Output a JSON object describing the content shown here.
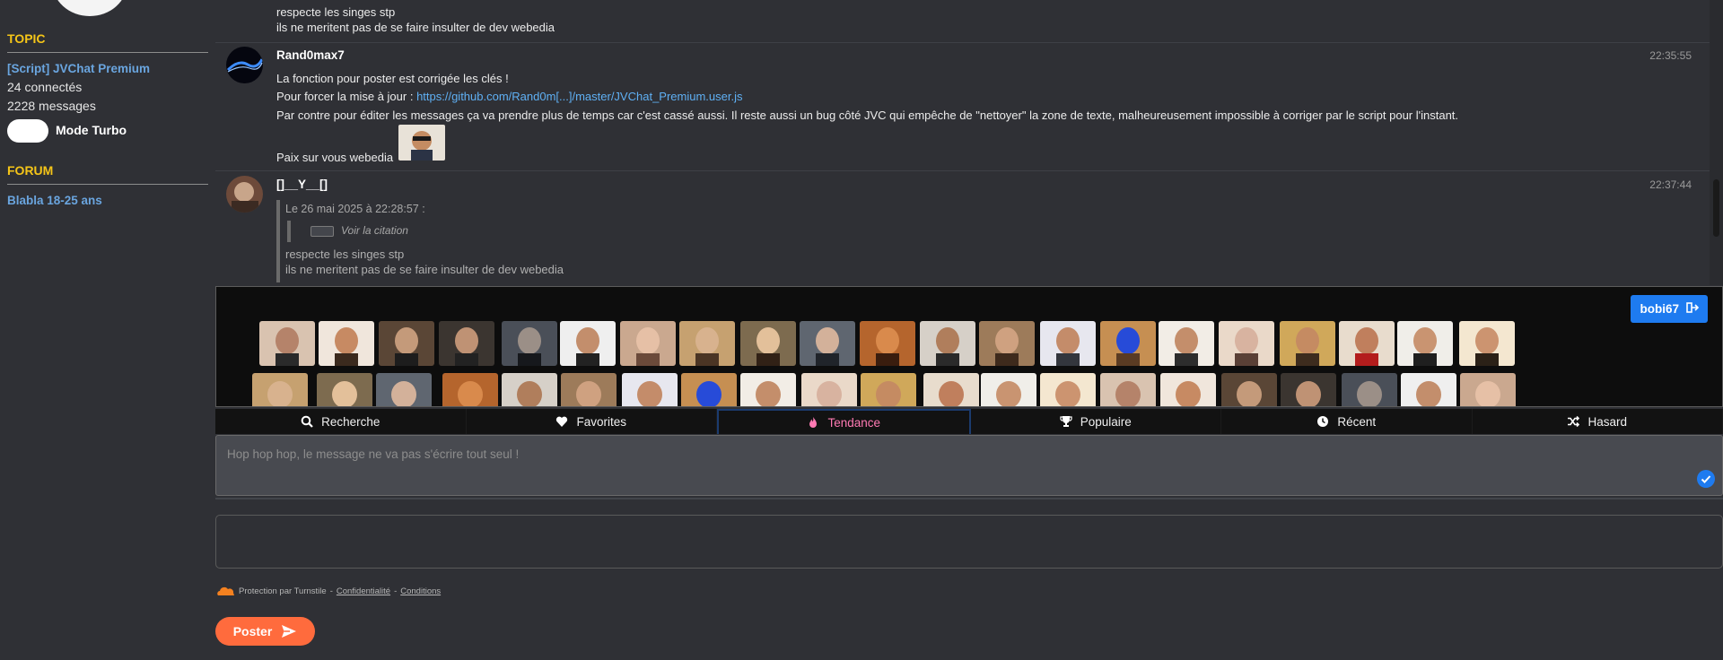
{
  "sidebar": {
    "topic_heading": "TOPIC",
    "topic_title": "[Script] JVChat Premium",
    "connected": "24 connectés",
    "messages": "2228 messages",
    "turbo_label": "Mode Turbo",
    "forum_heading": "FORUM",
    "forum_name": "Blabla 18-25 ans"
  },
  "messages": [
    {
      "lines": [
        "respecte les singes stp",
        "ils ne meritent pas de se faire insulter de dev webedia"
      ]
    },
    {
      "author": "Rand0max7",
      "time": "22:35:55",
      "line1": "La fonction pour poster est corrigée les clés !",
      "line2_prefix": "Pour forcer la mise à jour : ",
      "line2_link": "https://github.com/Rand0m[...]/master/JVChat_Premium.user.js",
      "line3": "Par contre pour éditer les messages ça va prendre plus de temps car c'est cassé aussi. Il reste aussi un bug côté JVC qui empêche de \"nettoyer\" la zone de texte, malheureusement impossible à corriger par le script pour l'instant.",
      "line4": "Paix sur vous webedia"
    },
    {
      "author": "[]__Y__[]",
      "time": "22:37:44",
      "quote_header": "Le 26 mai 2025 à 22:28:57 :",
      "quote_link": "Voir la citation",
      "quote_lines": [
        "respecte les singes stp",
        "ils ne meritent pas de se faire insulter de dev webedia"
      ]
    }
  ],
  "stickers": {
    "user": "bobi67"
  },
  "tabs": [
    {
      "label": "Recherche",
      "icon": "search-icon"
    },
    {
      "label": "Favorites",
      "icon": "heart-icon"
    },
    {
      "label": "Tendance",
      "icon": "flame-icon"
    },
    {
      "label": "Populaire",
      "icon": "trophy-icon"
    },
    {
      "label": "Récent",
      "icon": "clock-icon"
    },
    {
      "label": "Hasard",
      "icon": "shuffle-icon"
    }
  ],
  "composer": {
    "placeholder": "Hop hop hop, le message ne va pas s'écrire tout seul !"
  },
  "captcha": {
    "protection": "Protection par Turnstile",
    "sep": " - ",
    "privacy": "Confidentialité",
    "terms": "Conditions"
  },
  "post_button": "Poster",
  "colors": {
    "accent_yellow": "#f5c518",
    "link_blue": "#6aa5df",
    "post_orange": "#ff6b3d",
    "active_tab_pink": "#ff7ab3",
    "chip_blue": "#1e7bf0"
  }
}
